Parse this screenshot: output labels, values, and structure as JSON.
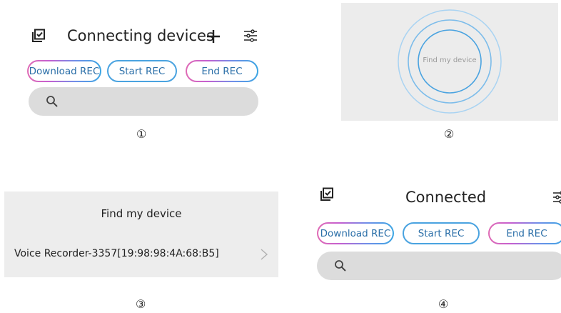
{
  "panel1": {
    "title": "Connecting devices",
    "buttons": {
      "download": "Download REC",
      "start": "Start REC",
      "end": "End REC"
    },
    "search_placeholder": "",
    "caption": "①"
  },
  "panel2": {
    "label": "Find my device",
    "caption": "②"
  },
  "panel3": {
    "title": "Find my device",
    "device": "Voice Recorder-3357[19:98:98:4A:68:B5]",
    "caption": "③"
  },
  "panel4": {
    "title": "Connected",
    "buttons": {
      "download": "Download REC",
      "start": "Start REC",
      "end": "End REC"
    },
    "search_placeholder": "",
    "caption": "④"
  },
  "icons": {
    "history": "history-checklist-icon",
    "add": "plus-icon",
    "filter": "sliders-icon",
    "search": "search-icon",
    "chevron": "chevron-right-icon"
  },
  "colors": {
    "accent_blue": "#4aa3e0",
    "accent_pink": "#e06bb5",
    "button_text": "#2b6fa8",
    "search_bg": "#dcdcdc"
  }
}
